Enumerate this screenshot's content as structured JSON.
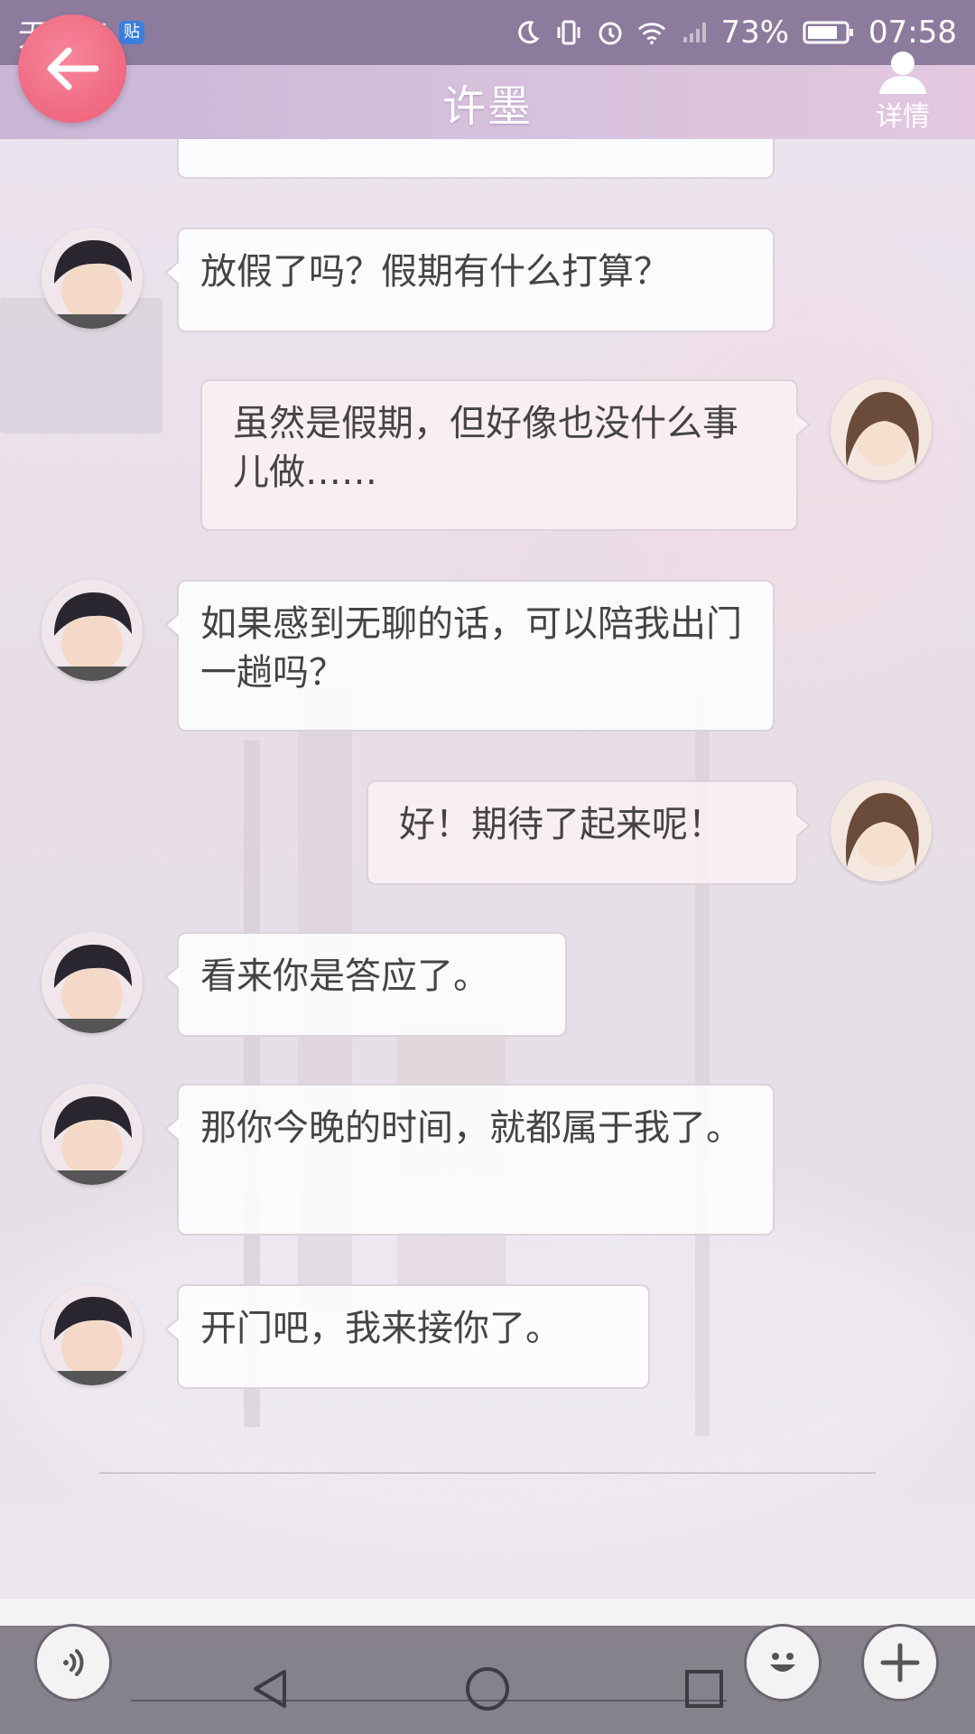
{
  "status_bar": {
    "carrier": "无服务",
    "badge": "贴",
    "battery": "73%",
    "time": "07:58",
    "icons": [
      "moon-icon",
      "vibrate-icon",
      "alarm-icon",
      "wifi-icon",
      "signal-icon",
      "battery-icon"
    ]
  },
  "header": {
    "title": "许墨",
    "details_label": "详情",
    "back_icon": "arrow-left-icon"
  },
  "messages": [
    {
      "side": "left",
      "sender": "许墨",
      "text": "放假了吗？假期有什么打算？"
    },
    {
      "side": "right",
      "sender": "me",
      "text": "虽然是假期，但好像也没什么事儿做……"
    },
    {
      "side": "left",
      "sender": "许墨",
      "text": "如果感到无聊的话，可以陪我出门一趟吗？"
    },
    {
      "side": "right",
      "sender": "me",
      "text": "好！期待了起来呢！"
    },
    {
      "side": "left",
      "sender": "许墨",
      "text": "看来你是答应了。"
    },
    {
      "side": "left",
      "sender": "许墨",
      "text": "那你今晚的时间，就都属于我了。"
    },
    {
      "side": "left",
      "sender": "许墨",
      "text": "开门吧，我来接你了。"
    }
  ],
  "bottom": {
    "icons": [
      "voice-icon",
      "back-triangle-icon",
      "home-circle-icon",
      "recents-square-icon",
      "emoji-icon",
      "plus-icon"
    ]
  },
  "colors": {
    "back_button": "#ec5d77",
    "header": "#d6c0dc",
    "status_bar": "#78648c"
  }
}
